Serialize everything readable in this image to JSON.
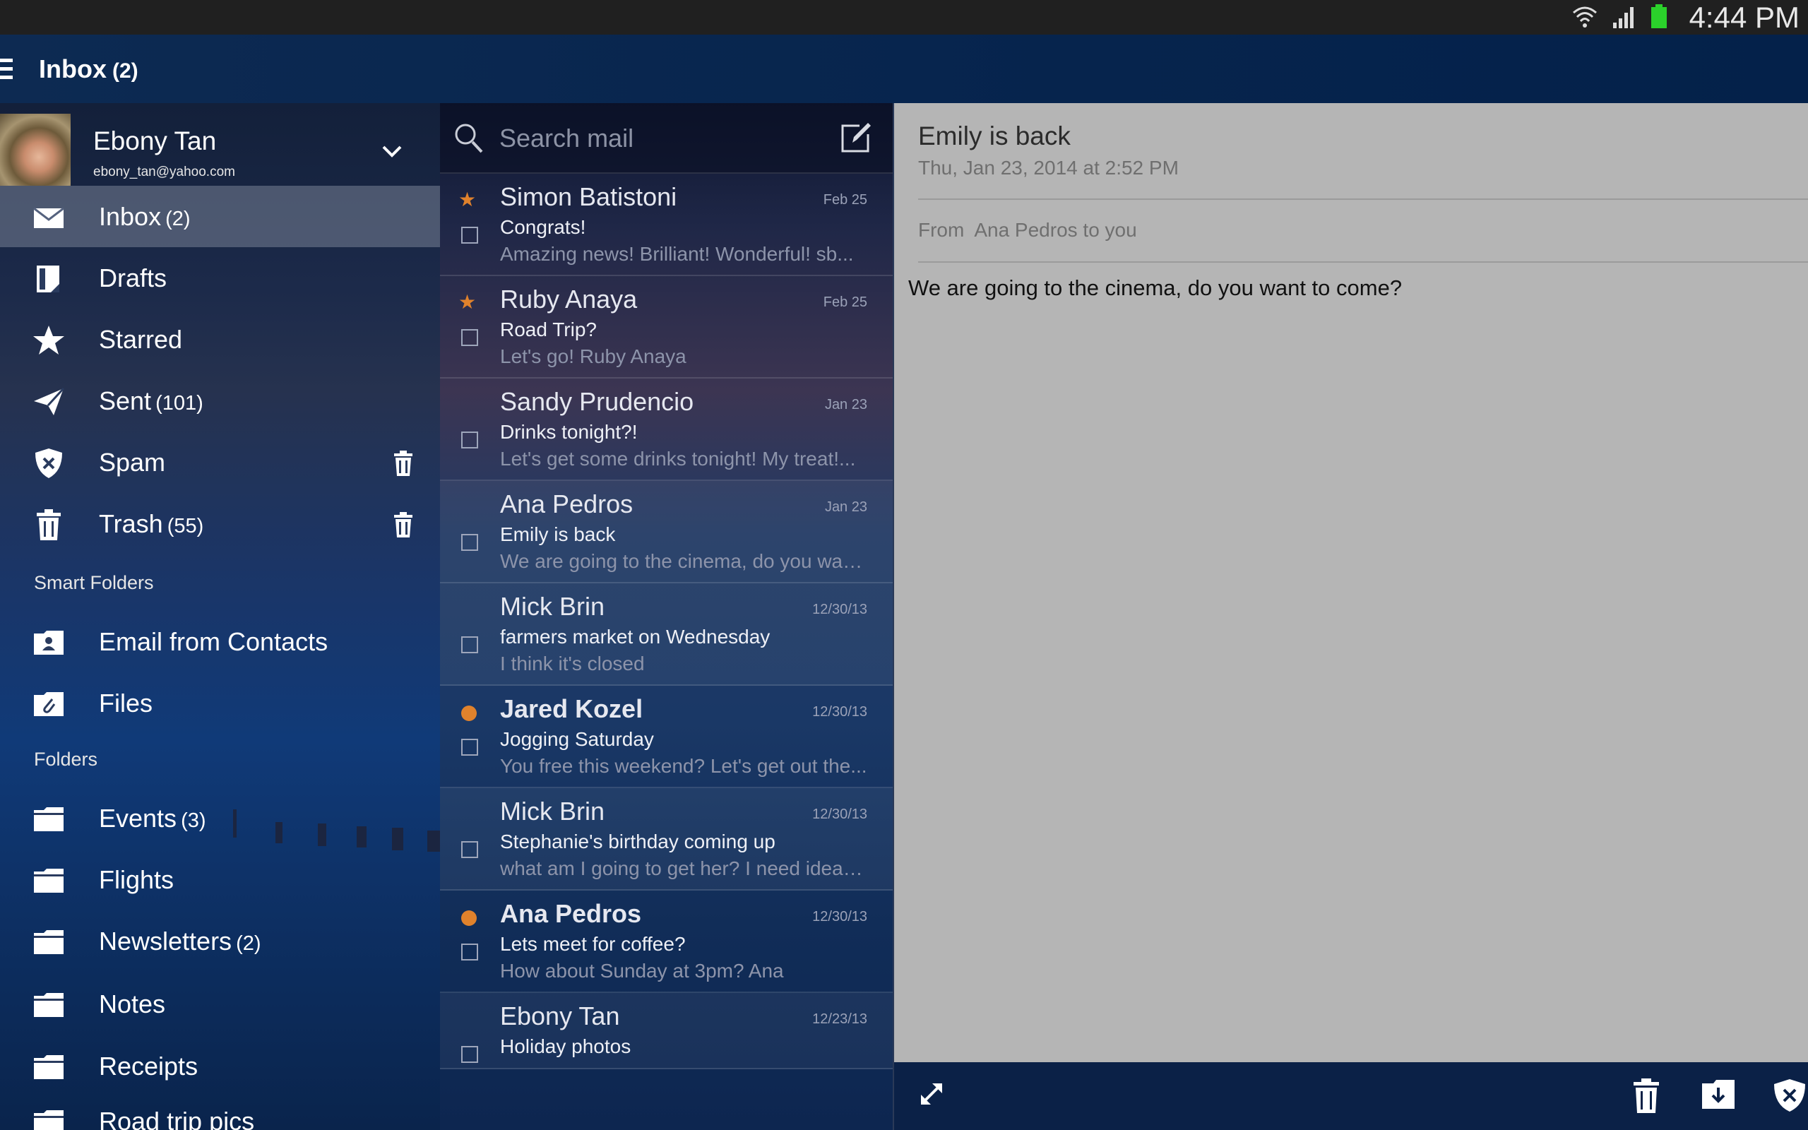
{
  "status_bar": {
    "time": "4:44 PM"
  },
  "app_bar": {
    "title": "Inbox",
    "count": "(2)"
  },
  "account": {
    "name": "Ebony Tan",
    "email": "ebony_tan@yahoo.com"
  },
  "sidebar": {
    "items": [
      {
        "label": "Inbox",
        "count": "(2)"
      },
      {
        "label": "Drafts",
        "count": ""
      },
      {
        "label": "Starred",
        "count": ""
      },
      {
        "label": "Sent",
        "count": "(101)"
      },
      {
        "label": "Spam",
        "count": ""
      },
      {
        "label": "Trash",
        "count": "(55)"
      }
    ],
    "smart_folders_header": "Smart Folders",
    "smart_folders": [
      {
        "label": "Email from Contacts"
      },
      {
        "label": "Files"
      }
    ],
    "folders_header": "Folders",
    "folders": [
      {
        "label": "Events",
        "count": "(3)"
      },
      {
        "label": "Flights",
        "count": ""
      },
      {
        "label": "Newsletters",
        "count": "(2)"
      },
      {
        "label": "Notes",
        "count": ""
      },
      {
        "label": "Receipts",
        "count": ""
      },
      {
        "label": "Road trip pics",
        "count": ""
      }
    ]
  },
  "search": {
    "placeholder": "Search mail"
  },
  "messages": [
    {
      "sender": "Simon Batistoni",
      "date": "Feb 25",
      "subject": "Congrats!",
      "preview": "Amazing news! Brilliant!  Wonderful!  sb...",
      "starred": true,
      "unread": false
    },
    {
      "sender": "Ruby Anaya",
      "date": "Feb 25",
      "subject": "Road Trip?",
      "preview": "Let's go! Ruby Anaya",
      "starred": true,
      "unread": false
    },
    {
      "sender": "Sandy Prudencio",
      "date": "Jan 23",
      "subject": "Drinks tonight?!",
      "preview": "Let's get some drinks tonight! My treat!...",
      "starred": false,
      "unread": false
    },
    {
      "sender": "Ana Pedros",
      "date": "Jan 23",
      "subject": "Emily is back",
      "preview": "We are going to the cinema, do you wan...",
      "starred": false,
      "unread": false
    },
    {
      "sender": "Mick Brin",
      "date": "12/30/13",
      "subject": "farmers market on Wednesday",
      "preview": "I think it's closed",
      "starred": false,
      "unread": false
    },
    {
      "sender": "Jared Kozel",
      "date": "12/30/13",
      "subject": "Jogging Saturday",
      "preview": "You free this weekend? Let's get out the...",
      "starred": false,
      "unread": true
    },
    {
      "sender": "Mick Brin",
      "date": "12/30/13",
      "subject": "Stephanie's birthday coming up",
      "preview": "what am I going to get her? I need ideas...",
      "starred": false,
      "unread": false
    },
    {
      "sender": "Ana Pedros",
      "date": "12/30/13",
      "subject": "Lets meet for coffee?",
      "preview": "How about Sunday at 3pm? Ana",
      "starred": false,
      "unread": true
    },
    {
      "sender": "Ebony Tan",
      "date": "12/23/13",
      "subject": "Holiday photos",
      "preview": "",
      "starred": false,
      "unread": false
    }
  ],
  "reader": {
    "subject": "Emily is back",
    "date": "Thu, Jan 23, 2014 at 2:52 PM",
    "from_label": "From",
    "from_text": "Ana Pedros to you",
    "body": "We are going to the cinema, do you want to come?"
  },
  "colors": {
    "accent_orange": "#e0822c",
    "app_bar": "#06244d",
    "reader_bg": "#b5b5b5"
  }
}
